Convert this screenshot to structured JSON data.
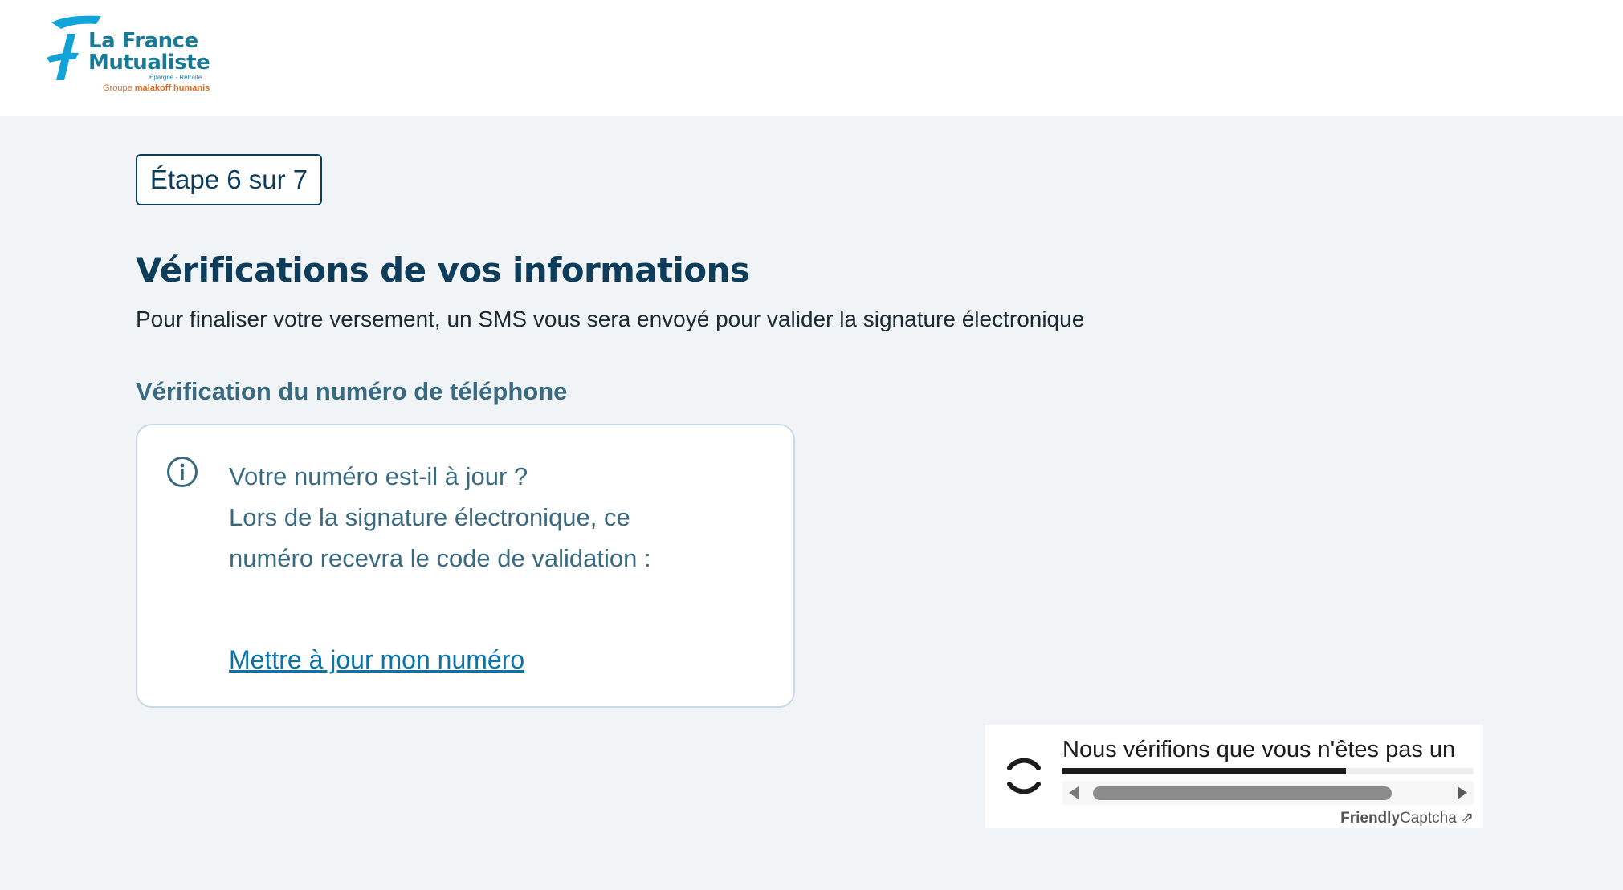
{
  "header": {
    "logo": {
      "line1": "La France",
      "line2": "Mutualiste",
      "tagline": "Épargne - Retraite",
      "group_prefix": "Groupe ",
      "group_name": "malakoff humanis"
    }
  },
  "main": {
    "step": "Étape 6 sur 7",
    "title": "Vérifications de vos informations",
    "description": "Pour finaliser votre versement, un SMS vous sera envoyé pour valider la signature électronique",
    "section_title": "Vérification du numéro de téléphone",
    "info_card": {
      "icon": "info-icon",
      "lines": [
        "Votre numéro est-il à jour ?",
        "Lors de la signature électronique, ce",
        "numéro recevra le code de validation :"
      ],
      "link": "Mettre à jour mon numéro"
    }
  },
  "captcha": {
    "text": "Nous vérifions que vous n'êtes pas un",
    "progress": 0.69,
    "brand_bold": "Friendly",
    "brand_rest": "Captcha",
    "brand_icon": "external-link-icon",
    "brand_arrow": "⇗"
  },
  "colors": {
    "primary": "#0d3d5a",
    "secondary": "#3a6a80",
    "link": "#0a74a8",
    "background": "#f0f4f6",
    "logo_blue": "#1a7a95",
    "logo_orange": "#e06a1e"
  }
}
